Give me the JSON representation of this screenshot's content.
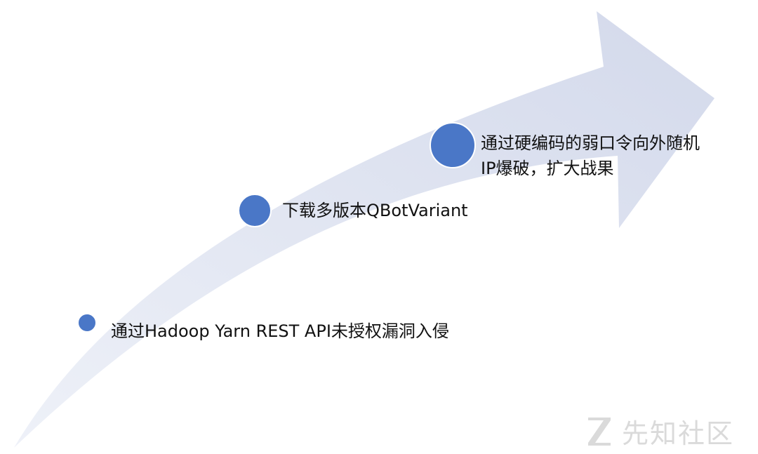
{
  "steps": [
    {
      "label": "通过Hadoop Yarn REST API未授权漏洞入侵"
    },
    {
      "label": "下载多版本QBotVariant"
    },
    {
      "label_line1": "通过硬编码的弱口令向外随机",
      "label_line2": "IP爆破，扩大战果"
    }
  ],
  "watermark": {
    "text": "先知社区"
  },
  "colors": {
    "arrow": "#d6dbeb",
    "dot": "#4a77c7",
    "dot_ring": "#ffffff",
    "text": "#111111",
    "watermark": "#d6d6d6"
  }
}
